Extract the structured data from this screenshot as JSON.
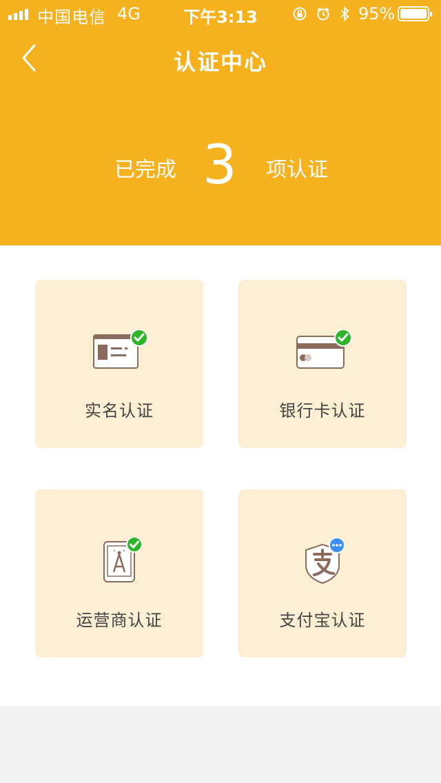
{
  "status_bar": {
    "carrier": "中国电信",
    "network": "4G",
    "time": "下午3:13",
    "battery": "95%",
    "battery_level": 0.95,
    "icons": [
      "rotation-lock-icon",
      "alarm-icon",
      "bluetooth-icon"
    ]
  },
  "nav": {
    "title": "认证中心",
    "back_icon": "chevron-left-icon"
  },
  "summary": {
    "prefix": "已完成",
    "count": "3",
    "suffix": "项认证"
  },
  "cards": [
    {
      "label": "实名认证",
      "icon": "id-card-icon",
      "status": "verified"
    },
    {
      "label": "银行卡认证",
      "icon": "bank-card-icon",
      "status": "verified"
    },
    {
      "label": "运营商认证",
      "icon": "mobile-operator-icon",
      "status": "verified"
    },
    {
      "label": "支付宝认证",
      "icon": "alipay-icon",
      "status": "pending"
    }
  ],
  "colors": {
    "header": "#f5b11e",
    "card_bg": "#fdefd3",
    "icon_brown": "#8b6c5c",
    "check_green": "#2fb52a",
    "pending_blue": "#3e8ff3"
  }
}
